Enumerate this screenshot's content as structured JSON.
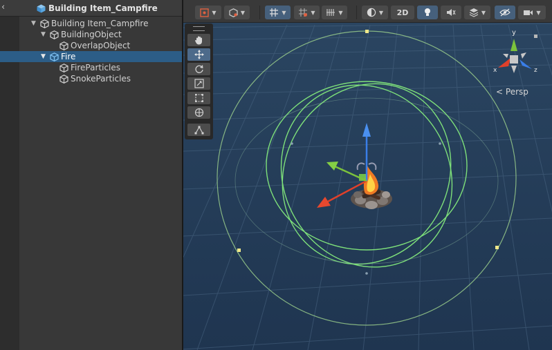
{
  "hierarchy": {
    "title": "Building Item_Campfire",
    "items": [
      {
        "label": "Building Item_Campfire",
        "depth": 0,
        "expanded": true,
        "selected": false
      },
      {
        "label": "BuildingObject",
        "depth": 1,
        "expanded": true,
        "selected": false
      },
      {
        "label": "OverlapObject",
        "depth": 2,
        "expanded": false,
        "selected": false
      },
      {
        "label": "Fire",
        "depth": 1,
        "expanded": true,
        "selected": true
      },
      {
        "label": "FireParticles",
        "depth": 2,
        "expanded": false,
        "selected": false
      },
      {
        "label": "SnokeParticles",
        "depth": 2,
        "expanded": false,
        "selected": false
      }
    ]
  },
  "scene_toolbar": {
    "mode_2d_label": "2D",
    "buttons": [
      "gizmo-pivot",
      "object-mode",
      "grid-snap",
      "increment-snap",
      "grid-view",
      "shading-mode",
      "2d-toggle",
      "lighting",
      "audio",
      "effects",
      "hidden-objects",
      "camera"
    ]
  },
  "tools": [
    "hand",
    "move",
    "rotate",
    "scale",
    "rect",
    "transform",
    "custom"
  ],
  "orientation": {
    "projection_label": "Persp",
    "axes": {
      "y": "y",
      "x": "x",
      "z": "z"
    }
  },
  "colors": {
    "selection": "#2c5d87",
    "scene_bg": "#233a56",
    "grid": "#456078",
    "collider": "#9cd08a",
    "axis_x": "#e0402a",
    "axis_y": "#7cc23c",
    "axis_z": "#3a7ee8"
  }
}
